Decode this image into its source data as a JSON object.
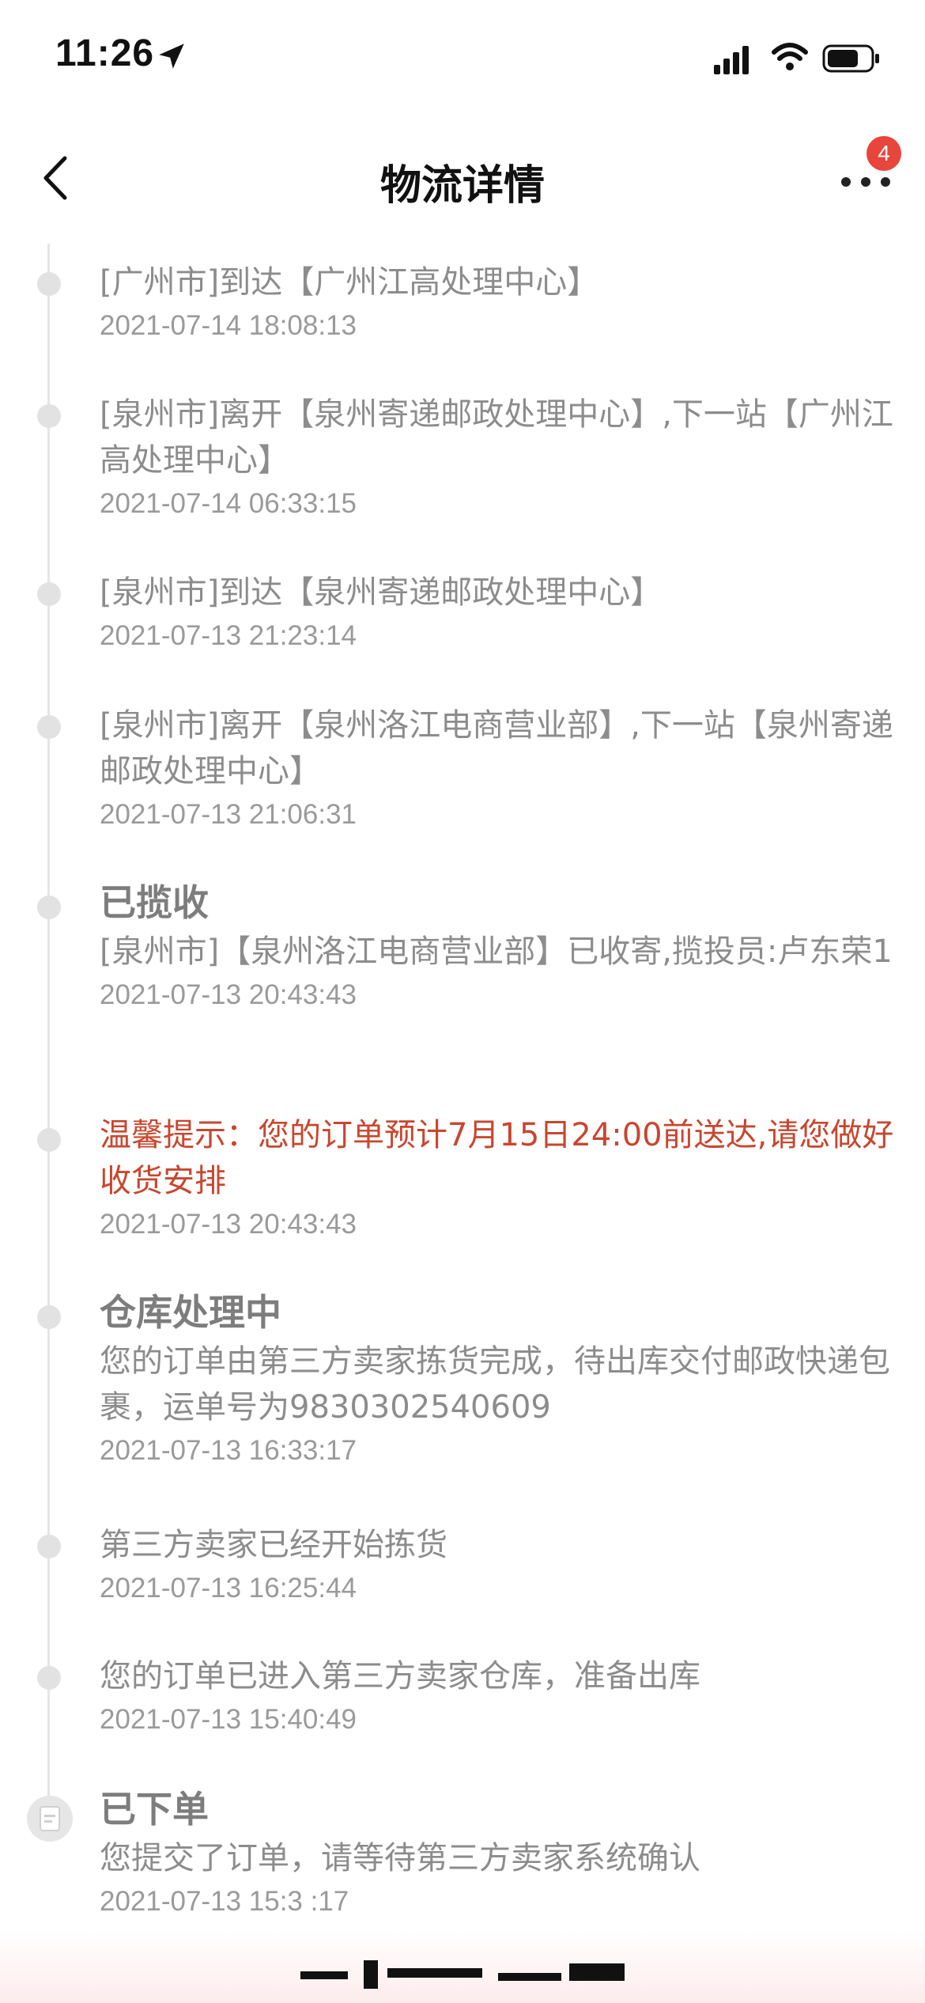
{
  "status_bar": {
    "time": "11:26",
    "icons": [
      "location-arrow-icon",
      "cellular-signal-icon",
      "wifi-icon",
      "battery-icon"
    ]
  },
  "nav": {
    "title": "物流详情",
    "back_icon": "chevron-left-icon",
    "more_icon": "more-dots-icon",
    "badge_count": "4"
  },
  "colors": {
    "accent_red": "#e8453c",
    "warm_tip_red": "#c9462e",
    "text_gray": "#8c8c8c",
    "time_gray": "#9a9a9a",
    "line_gray": "#e5e5e5"
  },
  "events": [
    {
      "heading": "",
      "text": "[广州市]到达【广州江高处理中心】",
      "time": "2021-07-14 18:08:13"
    },
    {
      "heading": "",
      "text": "[泉州市]离开【泉州寄递邮政处理中心】,下一站【广州江高处理中心】",
      "time": "2021-07-14 06:33:15"
    },
    {
      "heading": "",
      "text": "[泉州市]到达【泉州寄递邮政处理中心】",
      "time": "2021-07-13 21:23:14"
    },
    {
      "heading": "",
      "text": "[泉州市]离开【泉州洛江电商营业部】,下一站【泉州寄递邮政处理中心】",
      "time": "2021-07-13 21:06:31"
    },
    {
      "heading": "已揽收",
      "text": "[泉州市]【泉州洛江电商营业部】已收寄,揽投员:卢东荣1",
      "time": "2021-07-13 20:43:43"
    },
    {
      "heading": "",
      "text": "温馨提示：您的订单预计7月15日24:00前送达,请您做好收货安排",
      "time": "2021-07-13 20:43:43",
      "highlight": true
    },
    {
      "heading": "仓库处理中",
      "text": "您的订单由第三方卖家拣货完成，待出库交付邮政快递包裹，运单号为9830302540609",
      "time": "2021-07-13 16:33:17"
    },
    {
      "heading": "",
      "text": "第三方卖家已经开始拣货",
      "time": "2021-07-13 16:25:44"
    },
    {
      "heading": "",
      "text": "您的订单已进入第三方卖家仓库，准备出库",
      "time": "2021-07-13 15:40:49"
    },
    {
      "heading": "已下单",
      "text": "您提交了订单，请等待第三方卖家系统确认",
      "time": "2021-07-13 15:3 :17",
      "icon": "order-document-icon"
    }
  ]
}
